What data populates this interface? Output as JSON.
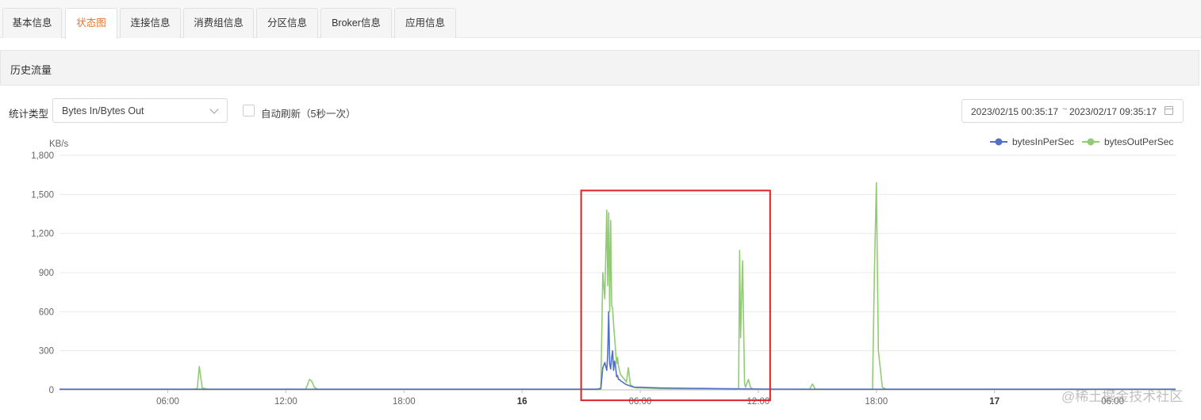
{
  "tabs": [
    {
      "label": "基本信息",
      "active": false
    },
    {
      "label": "状态图",
      "active": true
    },
    {
      "label": "连接信息",
      "active": false
    },
    {
      "label": "消费组信息",
      "active": false
    },
    {
      "label": "分区信息",
      "active": false
    },
    {
      "label": "Broker信息",
      "active": false
    },
    {
      "label": "应用信息",
      "active": false
    }
  ],
  "section": {
    "title": "历史流量"
  },
  "filters": {
    "stat_type_label": "统计类型",
    "stat_type_value": "Bytes In/Bytes Out",
    "auto_refresh_label": "自动刷新（5秒一次）",
    "auto_refresh_checked": false,
    "date_start": "2023/02/15 00:35:17",
    "date_separator": "~",
    "date_end": "2023/02/17 09:35:17"
  },
  "watermark": "@稀土掘金技术社区",
  "colors": {
    "accent": "#e8742f",
    "series_in": "#5470c6",
    "series_out": "#91cc75",
    "highlight_box": "#e02020"
  },
  "icons": {
    "select": "chevron-down-icon",
    "date": "calendar-icon"
  },
  "chart_data": {
    "type": "line",
    "ylabel": "KB/s",
    "ylim": [
      0,
      1800
    ],
    "y_ticks": [
      0,
      300,
      600,
      900,
      1200,
      1500,
      1800
    ],
    "y_tick_labels": [
      "0",
      "300",
      "600",
      "900",
      "1,200",
      "1,500",
      "1,800"
    ],
    "xlim": [
      0.5,
      57.2
    ],
    "x_ticks": [
      {
        "x": 6,
        "label": "06:00",
        "bold": false
      },
      {
        "x": 12,
        "label": "12:00",
        "bold": false
      },
      {
        "x": 18,
        "label": "18:00",
        "bold": false
      },
      {
        "x": 24,
        "label": "16",
        "bold": true
      },
      {
        "x": 30,
        "label": "06:00",
        "bold": false
      },
      {
        "x": 36,
        "label": "12:00",
        "bold": false
      },
      {
        "x": 42,
        "label": "18:00",
        "bold": false
      },
      {
        "x": 48,
        "label": "17",
        "bold": true
      },
      {
        "x": 54,
        "label": "06:00",
        "bold": false
      }
    ],
    "grid": true,
    "legend_position": "top-right",
    "series": [
      {
        "name": "bytesInPerSec",
        "color": "#5470c6",
        "x": [
          0.5,
          27.8,
          28.0,
          28.1,
          28.2,
          28.3,
          28.35,
          28.4,
          28.45,
          28.5,
          28.55,
          28.6,
          28.65,
          28.7,
          28.75,
          28.8,
          28.85,
          28.9,
          28.95,
          29.0,
          29.1,
          29.2,
          29.3,
          29.5,
          29.7,
          30.0,
          31.0,
          32.5,
          34.0,
          35.0,
          36.5,
          39.0,
          45.0,
          50.0,
          57.2
        ],
        "y": [
          5,
          5,
          8,
          170,
          210,
          150,
          270,
          600,
          200,
          160,
          250,
          300,
          150,
          220,
          180,
          100,
          110,
          80,
          80,
          70,
          60,
          50,
          40,
          30,
          20,
          20,
          15,
          12,
          10,
          8,
          6,
          5,
          5,
          5,
          5
        ]
      },
      {
        "name": "bytesOutPerSec",
        "color": "#91cc75",
        "x": [
          0.5,
          7.3,
          7.5,
          7.6,
          7.75,
          8.0,
          13.0,
          13.1,
          13.2,
          13.3,
          13.45,
          13.6,
          27.8,
          28.0,
          28.1,
          28.2,
          28.3,
          28.35,
          28.4,
          28.45,
          28.5,
          28.55,
          28.6,
          28.65,
          28.7,
          28.75,
          28.8,
          28.85,
          28.9,
          28.95,
          29.0,
          29.1,
          29.2,
          29.3,
          29.4,
          29.5,
          29.6,
          29.7,
          29.8,
          30.0,
          30.5,
          31.0,
          32.5,
          34.0,
          34.9,
          35.0,
          35.05,
          35.1,
          35.2,
          35.3,
          35.35,
          35.4,
          35.5,
          35.6,
          35.7,
          35.8,
          36.0,
          38.6,
          38.75,
          38.9,
          39.0,
          41.8,
          41.9,
          42.0,
          42.1,
          42.3,
          42.5,
          50.0,
          57.2
        ],
        "y": [
          5,
          5,
          10,
          180,
          15,
          5,
          5,
          40,
          80,
          70,
          20,
          5,
          5,
          15,
          900,
          700,
          1380,
          800,
          1360,
          600,
          1300,
          650,
          620,
          500,
          400,
          300,
          200,
          250,
          180,
          150,
          120,
          100,
          80,
          60,
          170,
          40,
          30,
          20,
          15,
          15,
          12,
          10,
          8,
          6,
          5,
          10,
          1070,
          400,
          990,
          50,
          20,
          40,
          80,
          20,
          10,
          5,
          5,
          5,
          45,
          5,
          5,
          5,
          900,
          1590,
          300,
          20,
          5,
          5,
          5
        ]
      }
    ],
    "annotations": [
      {
        "type": "box",
        "x_from": 27.0,
        "x_to": 36.6,
        "y_from": -80,
        "y_to": 1530,
        "color": "#e02020"
      }
    ]
  }
}
